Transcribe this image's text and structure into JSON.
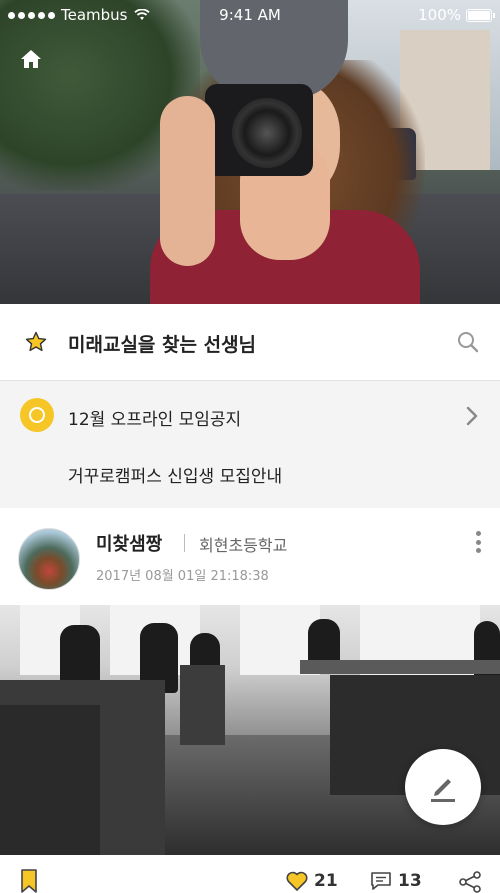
{
  "status_bar": {
    "carrier": "Teambus",
    "time": "9:41 AM",
    "battery": "100%"
  },
  "icons": {
    "home": "home-icon",
    "star": "star-icon",
    "search": "search-icon",
    "notice": "broadcast-icon",
    "chevron": "chevron-right-icon",
    "more": "more-vertical-icon",
    "write": "pencil-icon",
    "bookmark": "bookmark-icon",
    "like": "heart-icon",
    "comment": "comment-icon",
    "share": "share-icon"
  },
  "colors": {
    "accent": "#f5c626",
    "bookmark": "#f0b400"
  },
  "community": {
    "title": "미래교실을 찾는 선생님"
  },
  "notices": [
    {
      "text": "12월 오프라인 모임공지"
    },
    {
      "text": "거꾸로캠퍼스 신입생 모집안내"
    }
  ],
  "post": {
    "author": "미찾샘짱",
    "school": "회현초등학교",
    "date": "2017년 08월 01일 21:18:38",
    "likes": "21",
    "comments": "13"
  }
}
